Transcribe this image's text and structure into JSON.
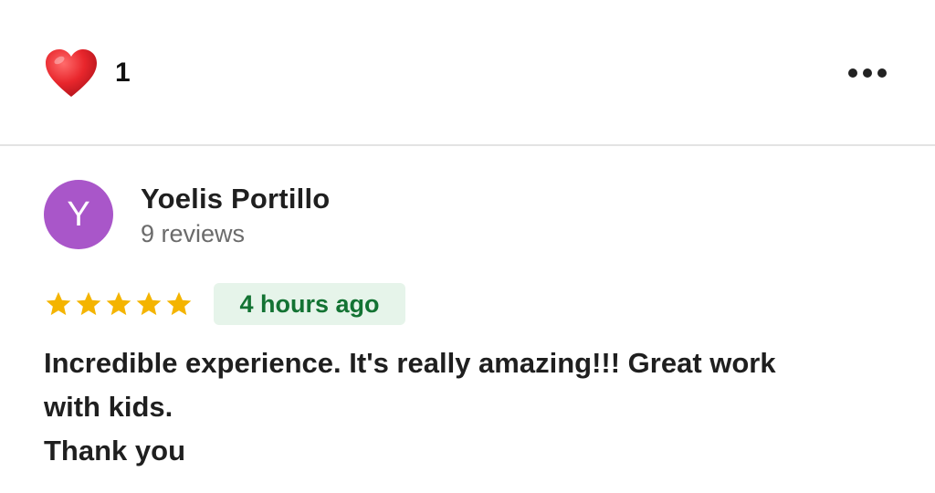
{
  "likes": {
    "icon": "heart-icon",
    "count": "1",
    "heart_color": "#e8262c"
  },
  "menu": {
    "icon": "more-horizontal-icon"
  },
  "review": {
    "author": {
      "initial": "Y",
      "name": "Yoelis Portillo",
      "review_count": "9 reviews",
      "avatar_color": "#a956c9"
    },
    "rating": 5,
    "max_rating": 5,
    "star_color": "#f4b400",
    "time_ago": "4 hours ago",
    "text_lines": [
      "Incredible experience. It's really amazing!!! Great work",
      "with kids.",
      "Thank you"
    ]
  }
}
